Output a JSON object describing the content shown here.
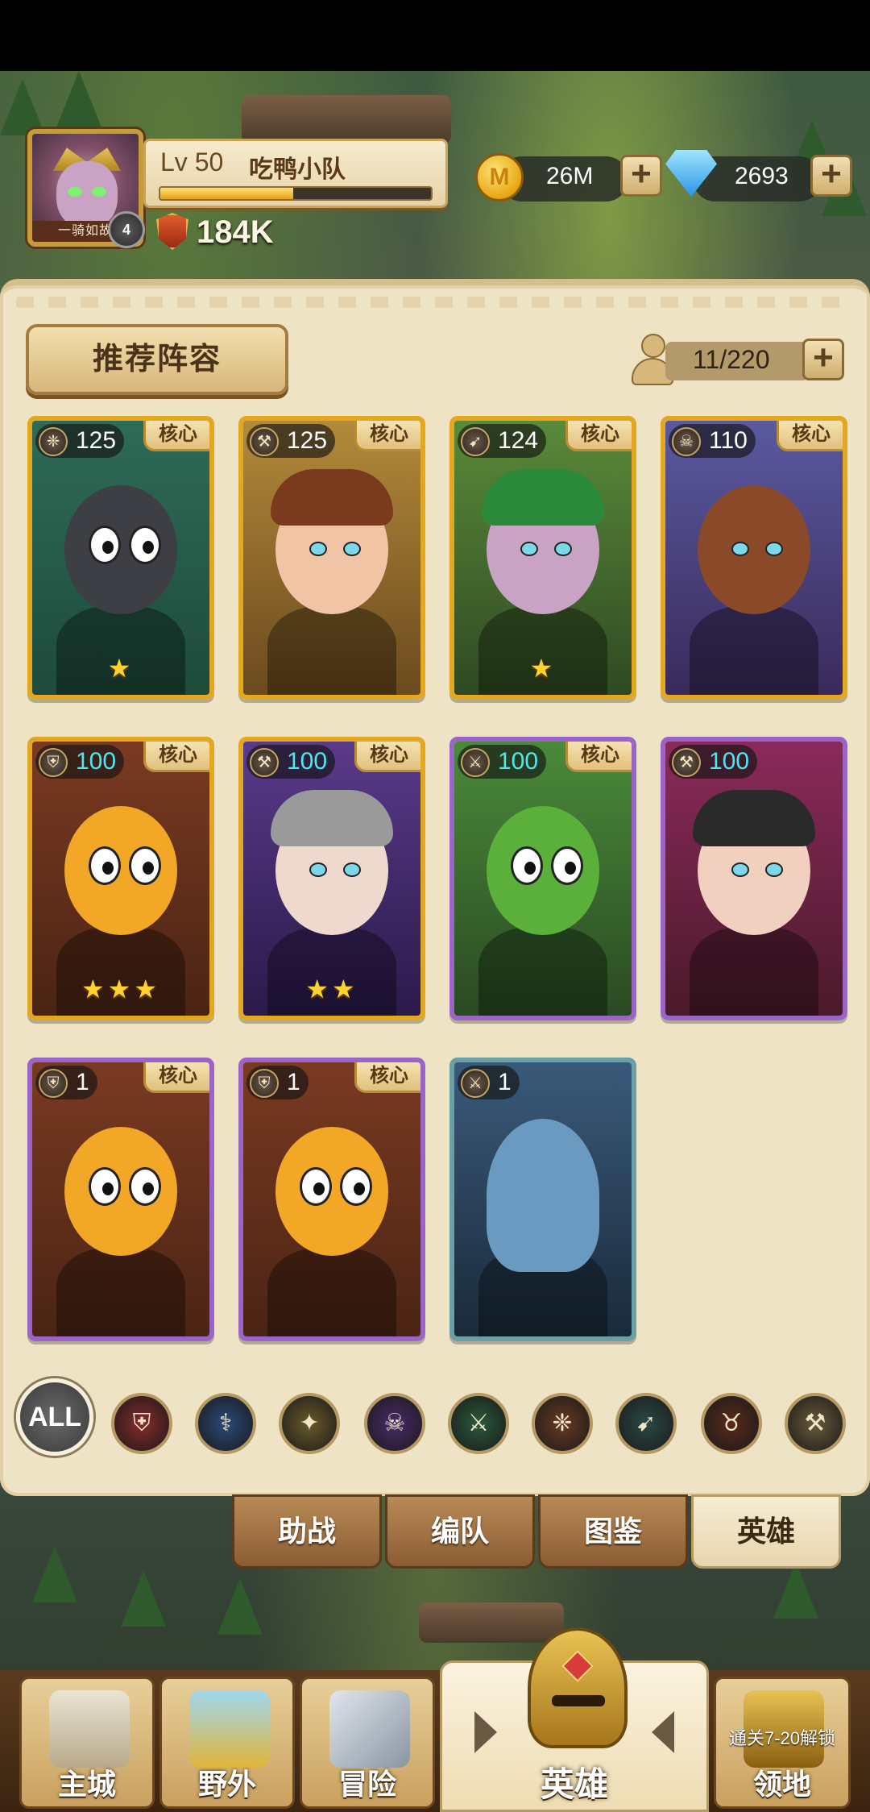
{
  "player": {
    "level_label": "Lv 50",
    "name": "吃鸭小队",
    "avatar_title": "一骑如故",
    "vip": "4",
    "power": "184K",
    "xp_fraction": 0.49
  },
  "resources": {
    "coin_symbol": "M",
    "coins": "26M",
    "gems": "2693",
    "plus": "+"
  },
  "panel": {
    "lineup_button": "推荐阵容",
    "capacity": "11/220"
  },
  "heroes": [
    {
      "level": "125",
      "class_icon": "paw-icon",
      "tag": "核心",
      "stars": "★",
      "rarity": "gold"
    },
    {
      "level": "125",
      "class_icon": "hammer-icon",
      "tag": "核心",
      "stars": "",
      "rarity": "gold"
    },
    {
      "level": "124",
      "class_icon": "bow-icon",
      "tag": "核心",
      "stars": "★",
      "rarity": "gold"
    },
    {
      "level": "110",
      "class_icon": "skull-icon",
      "tag": "核心",
      "stars": "",
      "rarity": "gold"
    },
    {
      "level": "100",
      "class_icon": "shield-icon",
      "tag": "核心",
      "stars": "★★★",
      "rarity": "gold"
    },
    {
      "level": "100",
      "class_icon": "hammer-icon",
      "tag": "核心",
      "stars": "★★",
      "rarity": "gold"
    },
    {
      "level": "100",
      "class_icon": "swords-icon",
      "tag": "核心",
      "stars": "",
      "rarity": "purple"
    },
    {
      "level": "100",
      "class_icon": "hammer-icon",
      "tag": "",
      "stars": "",
      "rarity": "purple"
    },
    {
      "level": "1",
      "class_icon": "shield-icon",
      "tag": "核心",
      "stars": "",
      "rarity": "purple"
    },
    {
      "level": "1",
      "class_icon": "shield-icon",
      "tag": "核心",
      "stars": "",
      "rarity": "purple"
    },
    {
      "level": "1",
      "class_icon": "swords-icon",
      "tag": "",
      "stars": "",
      "rarity": "teal"
    }
  ],
  "filters": {
    "all": "ALL",
    "icons": [
      "shield-icon",
      "staff-icon",
      "wings-icon",
      "skull-icon",
      "swords-icon",
      "paw-icon",
      "bow-icon",
      "bull-skull-icon",
      "hammer-icon"
    ]
  },
  "subtabs": [
    "助战",
    "编队",
    "图鉴",
    "英雄"
  ],
  "nav": {
    "items": [
      "主城",
      "野外",
      "冒险",
      "英雄",
      "领地"
    ],
    "locked_note": "通关7-20解锁"
  },
  "colors": {
    "gold_border": "#e3a820",
    "purple_border": "#9a64c8",
    "teal_border": "#6aa0a5",
    "level_cyan": "#4ee7ef"
  }
}
